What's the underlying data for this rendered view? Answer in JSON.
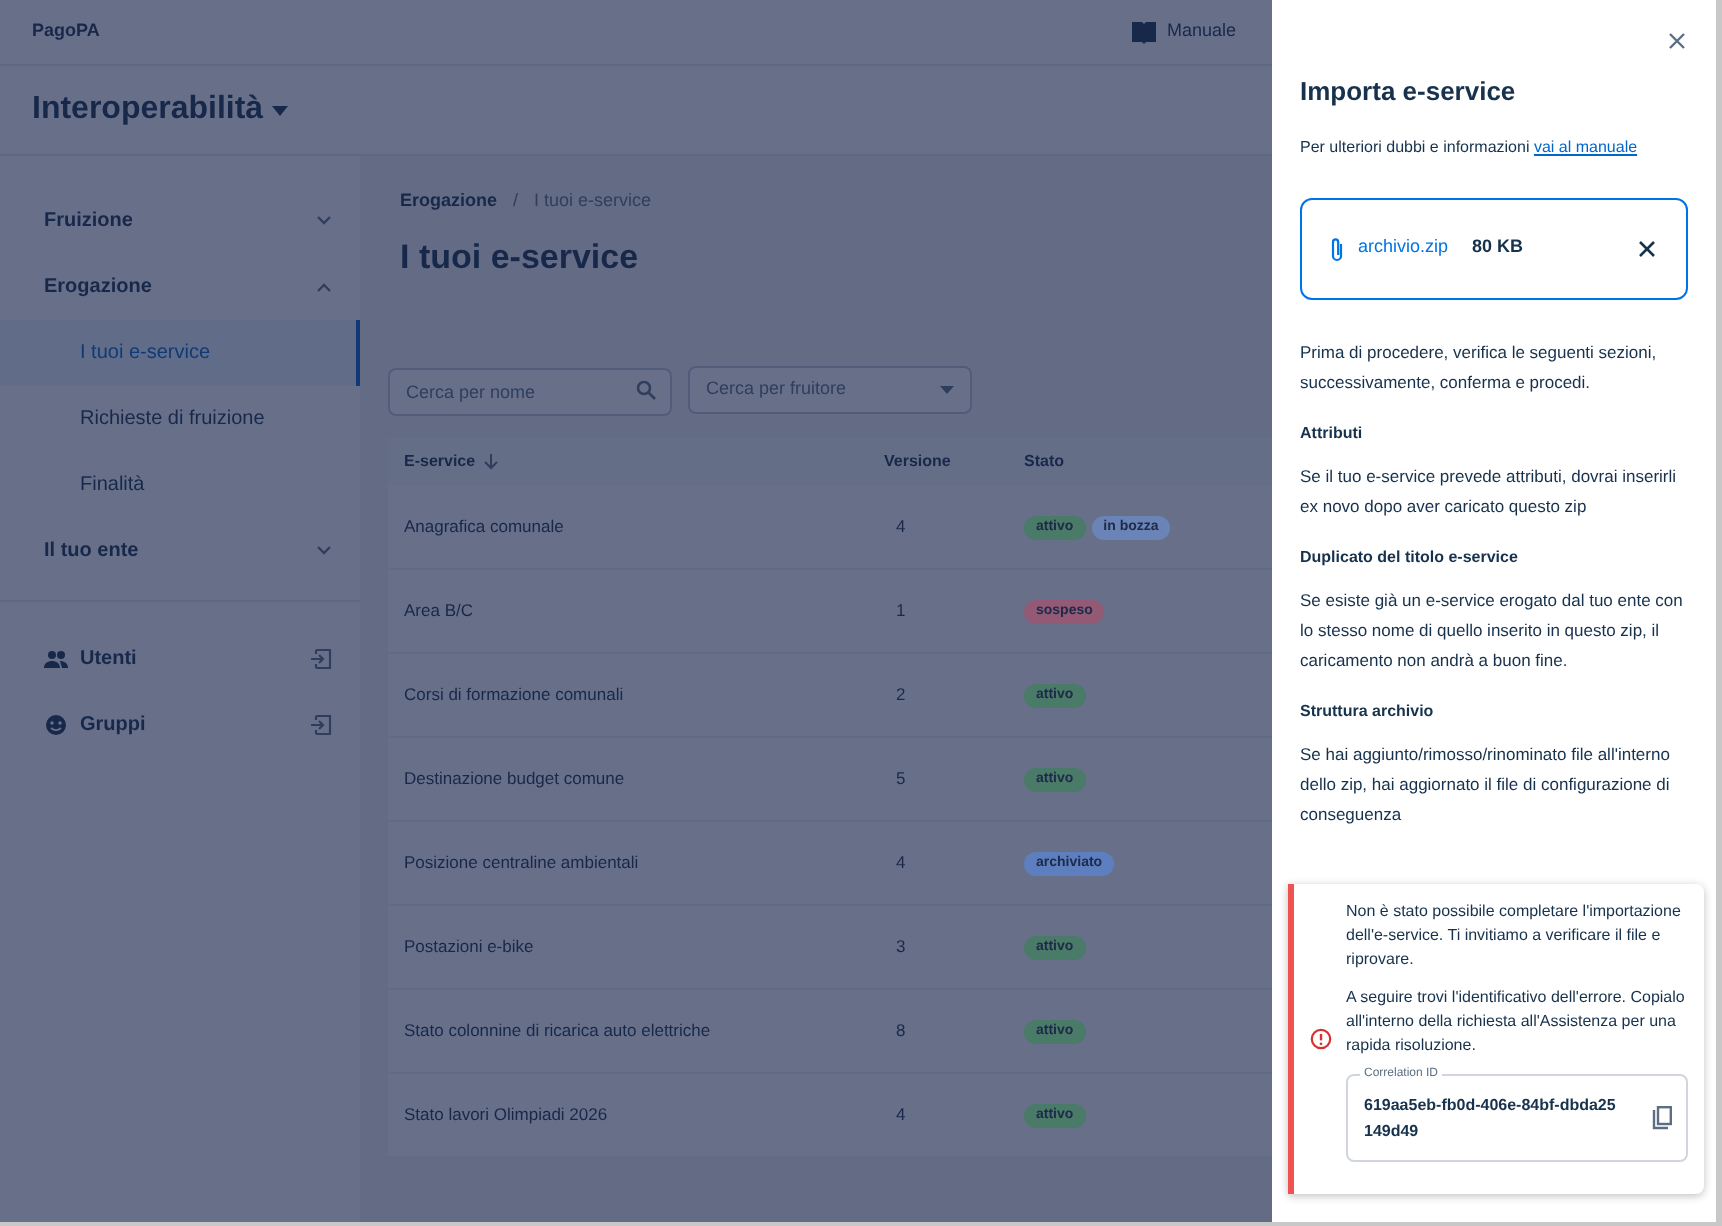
{
  "top_bar": {
    "brand": "PagoPA",
    "manual_link": "Manuale"
  },
  "product": {
    "title": "Interoperabilità"
  },
  "sidebar": {
    "items": [
      {
        "label": "Fruizione",
        "expanded": false
      },
      {
        "label": "Erogazione",
        "expanded": true,
        "children": [
          {
            "label": "I tuoi e-service",
            "selected": true
          },
          {
            "label": "Richieste di fruizione",
            "selected": false
          },
          {
            "label": "Finalità",
            "selected": false
          }
        ]
      },
      {
        "label": "Il tuo ente",
        "expanded": false
      }
    ],
    "links": [
      {
        "label": "Utenti",
        "kind": "users"
      },
      {
        "label": "Gruppi",
        "kind": "groups"
      }
    ]
  },
  "breadcrumb": {
    "items": [
      "Erogazione",
      "I tuoi e-service"
    ],
    "separator": "/"
  },
  "page_title": "I tuoi e-service",
  "filters": {
    "name_search": {
      "placeholder": "Cerca per nome"
    },
    "consumer_select": {
      "placeholder": "Cerca per fruitore"
    }
  },
  "table": {
    "columns": [
      "E-service",
      "Versione",
      "Stato"
    ],
    "rows": [
      {
        "name": "Anagrafica comunale",
        "version": "4",
        "badges": [
          {
            "label": "attivo",
            "color": "#4a7a68"
          },
          {
            "label": "in bozza",
            "color": "#6a84b8"
          }
        ]
      },
      {
        "name": "Area B/C",
        "version": "1",
        "badges": [
          {
            "label": "sospeso",
            "color": "#935a76"
          }
        ]
      },
      {
        "name": "Corsi di formazione comunali",
        "version": "2",
        "badges": [
          {
            "label": "attivo",
            "color": "#4a7a68"
          }
        ]
      },
      {
        "name": "Destinazione budget comune",
        "version": "5",
        "badges": [
          {
            "label": "attivo",
            "color": "#4a7a68"
          }
        ]
      },
      {
        "name": "Posizione centraline ambientali",
        "version": "4",
        "badges": [
          {
            "label": "archiviato",
            "color": "#5d7fc0"
          }
        ]
      },
      {
        "name": "Postazioni e-bike",
        "version": "3",
        "badges": [
          {
            "label": "attivo",
            "color": "#4a7a68"
          }
        ]
      },
      {
        "name": "Stato colonnine di ricarica auto elettriche",
        "version": "8",
        "badges": [
          {
            "label": "attivo",
            "color": "#4a7a68"
          }
        ]
      },
      {
        "name": "Stato lavori Olimpiadi 2026",
        "version": "4",
        "badges": [
          {
            "label": "attivo",
            "color": "#4a7a68"
          }
        ]
      }
    ]
  },
  "drawer": {
    "title": "Importa e-service",
    "intro": "Per ulteriori dubbi e informazioni",
    "intro_link": "vai al manuale",
    "file": {
      "name": "archivio.zip",
      "size": "80 KB"
    },
    "instructions": "Prima di procedere, verifica le seguenti sezioni, successivamente, conferma e procedi.",
    "sections": [
      {
        "title": "Attributi",
        "text": "Se il tuo e-service prevede attributi, dovrai inserirli ex novo dopo aver caricato questo zip"
      },
      {
        "title": "Duplicato del titolo e-service",
        "text": "Se esiste già un e-service erogato dal tuo ente con lo stesso nome di quello inserito in questo zip, il caricamento non andrà a buon fine."
      },
      {
        "title": "Struttura archivio",
        "text": "Se hai aggiunto/rimosso/rinominato file all'interno dello zip, hai aggiornato il file di configurazione di conseguenza"
      }
    ],
    "error_alert": {
      "messages": [
        "Non è stato possibile completare l'importazione dell'e-service. Ti invitiamo a verificare il file e riprovare.",
        "A seguire trovi l'identificativo dell'errore. Copialo all'interno della richiesta all'Assistenza per una rapida risoluzione."
      ],
      "field_label": "Correlation ID",
      "field_value": "619aa5eb-fb0d-406e-84bf-dbda25149d49"
    }
  }
}
